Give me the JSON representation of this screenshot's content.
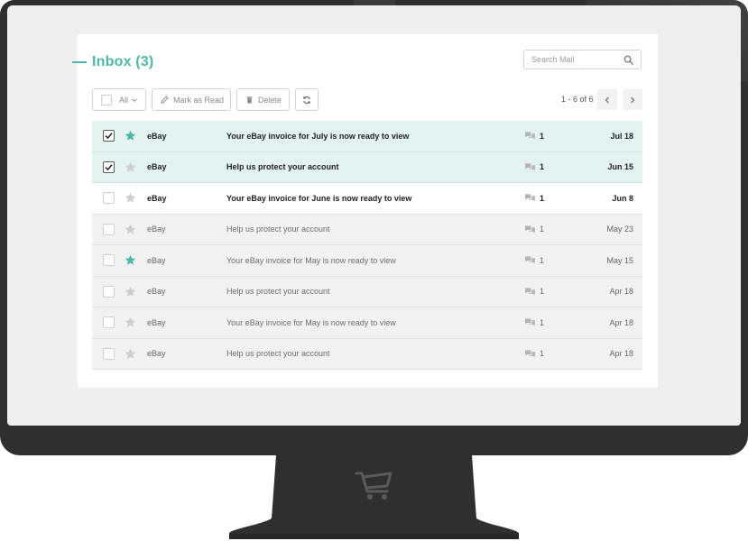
{
  "inbox": {
    "title": "Inbox (3)"
  },
  "search": {
    "placeholder": "Search Mail"
  },
  "toolbar": {
    "select_label": "All",
    "mark_read_label": "Mark as Read",
    "delete_label": "Delete"
  },
  "pager": {
    "text": "1 - 6 of 6"
  },
  "colors": {
    "accent": "#4fb7a8",
    "selected_row": "#e3f3f1",
    "read_row": "#f2f2f2",
    "frame": "#2f2f2f"
  },
  "messages": [
    {
      "sender": "eBay",
      "subject": "Your eBay invoice for July is now ready to view",
      "count": "1",
      "date": "Jul 18",
      "checked": true,
      "starred": true,
      "unread": true
    },
    {
      "sender": "eBay",
      "subject": "Help us protect your account",
      "count": "1",
      "date": "Jun 15",
      "checked": true,
      "starred": false,
      "unread": true
    },
    {
      "sender": "eBay",
      "subject": "Your eBay invoice for June is now ready to view",
      "count": "1",
      "date": "Jun 8",
      "checked": false,
      "starred": false,
      "unread": true
    },
    {
      "sender": "eBay",
      "subject": "Help us protect your account",
      "count": "1",
      "date": "May 23",
      "checked": false,
      "starred": false,
      "unread": false
    },
    {
      "sender": "eBay",
      "subject": "Your eBay invoice for May is now ready to view",
      "count": "1",
      "date": "May 15",
      "checked": false,
      "starred": true,
      "unread": false
    },
    {
      "sender": "eBay",
      "subject": "Help us protect your account",
      "count": "1",
      "date": "Apr 18",
      "checked": false,
      "starred": false,
      "unread": false
    },
    {
      "sender": "eBay",
      "subject": "Your eBay invoice for May is now ready to view",
      "count": "1",
      "date": "Apr 18",
      "checked": false,
      "starred": false,
      "unread": false
    },
    {
      "sender": "eBay",
      "subject": "Help us protect your account",
      "count": "1",
      "date": "Apr 18",
      "checked": false,
      "starred": false,
      "unread": false
    }
  ]
}
